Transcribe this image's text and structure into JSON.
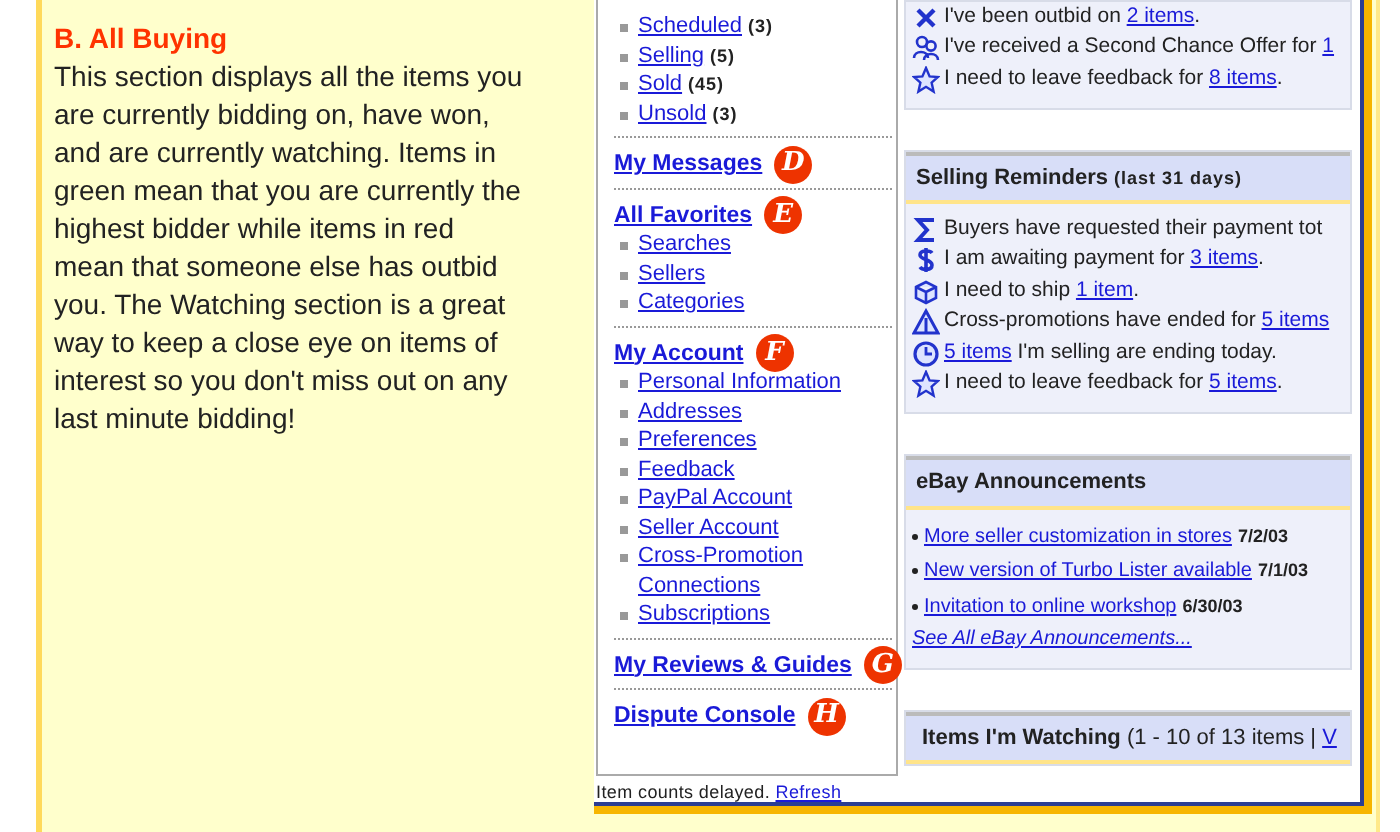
{
  "guide": {
    "heading": "B. All Buying",
    "body": "This section displays all the items you are currently bidding on, have won, and are currently watching. Items in green mean that you are currently the highest bidder while items in red mean that someone else has outbid you. The Watching section is a great way to keep a close eye on items of interest so you don't miss out on any last minute bidding!"
  },
  "screenshot": {
    "sidebar": {
      "sections": [
        {
          "items": [
            {
              "label": "Scheduled",
              "count": "(3)"
            },
            {
              "label": "Selling",
              "count": "(5)"
            },
            {
              "label": "Sold",
              "count": "(45)"
            },
            {
              "label": "Unsold",
              "count": "(3)"
            }
          ]
        },
        {
          "title": "My Messages",
          "marker": "D"
        },
        {
          "title": "All Favorites",
          "marker": "E",
          "items": [
            {
              "label": "Searches"
            },
            {
              "label": "Sellers"
            },
            {
              "label": "Categories"
            }
          ]
        },
        {
          "title": "My Account",
          "marker": "F",
          "items": [
            {
              "label": "Personal Information"
            },
            {
              "label": "Addresses"
            },
            {
              "label": "Preferences"
            },
            {
              "label": "Feedback"
            },
            {
              "label": "PayPal Account"
            },
            {
              "label": "Seller Account"
            },
            {
              "label": "Cross-Promotion Connections"
            },
            {
              "label": "Subscriptions"
            }
          ]
        },
        {
          "title": "My Reviews & Guides",
          "marker": "G"
        },
        {
          "title": "Dispute Console",
          "marker": "H"
        }
      ],
      "footer": {
        "text": "Item counts delayed.",
        "link": "Refresh"
      }
    },
    "buying_reminders": {
      "lines": [
        {
          "kind": "outbid",
          "before": "I've been outbid on ",
          "link": "2 items",
          "after": "."
        },
        {
          "kind": "offer",
          "before": "I've received a Second Chance Offer for ",
          "link": "1"
        },
        {
          "kind": "feedback",
          "before": "I need to leave feedback for ",
          "link": "8 items",
          "after": "."
        }
      ]
    },
    "selling_reminders": {
      "title": "Selling Reminders",
      "subtitle": "(last 31 days)",
      "lines": [
        {
          "kind": "request",
          "before": "Buyers have requested their payment tot"
        },
        {
          "kind": "payment",
          "before": "I am awaiting payment for ",
          "link": "3 items",
          "after": "."
        },
        {
          "kind": "ship",
          "before": "I need to ship ",
          "link": "1 item",
          "after": "."
        },
        {
          "kind": "promotion",
          "before": "Cross-promotions have ended for ",
          "link": "5 items"
        },
        {
          "kind": "ending",
          "link": "5 items",
          "after": " I'm selling are ending today."
        },
        {
          "kind": "feedback",
          "before": "I need to leave feedback for ",
          "link": "5 items",
          "after": "."
        }
      ]
    },
    "announcements": {
      "title": "eBay Announcements",
      "items": [
        {
          "link": "More seller customization in stores",
          "date": "7/2/03"
        },
        {
          "link": "New version of Turbo Lister available",
          "date": "7/1/03"
        },
        {
          "link": "Invitation to online workshop",
          "date": "6/30/03"
        }
      ],
      "see_all": "See All eBay Announcements..."
    },
    "watching": {
      "title": "Items I'm Watching",
      "range": "(1 - 10 of 13 items |",
      "link": "V"
    }
  }
}
